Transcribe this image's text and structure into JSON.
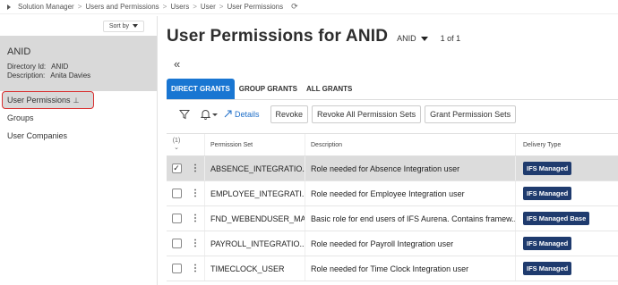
{
  "breadcrumb": {
    "items": [
      "Solution Manager",
      "Users and Permissions",
      "Users",
      "User",
      "User Permissions"
    ]
  },
  "sidebar": {
    "sort_label": "Sort by",
    "record": {
      "title": "ANID",
      "directory_label": "Directory Id:",
      "directory_value": "ANID",
      "description_label": "Description:",
      "description_value": "Anita Davies"
    },
    "items": [
      {
        "label": "User Permissions"
      },
      {
        "label": "Groups"
      },
      {
        "label": "User Companies"
      }
    ]
  },
  "header": {
    "title": "User Permissions for ANID",
    "selector_value": "ANID",
    "pager": "1 of 1"
  },
  "tabs": [
    {
      "label": "DIRECT GRANTS"
    },
    {
      "label": "GROUP GRANTS"
    },
    {
      "label": "ALL GRANTS"
    }
  ],
  "toolbar": {
    "details_label": "Details",
    "revoke_label": "Revoke",
    "revoke_all_label": "Revoke All Permission Sets",
    "grant_label": "Grant Permission Sets"
  },
  "table": {
    "selected_count": "(1)",
    "columns": {
      "permission_set": "Permission Set",
      "description": "Description",
      "delivery_type": "Delivery Type"
    },
    "rows": [
      {
        "permission_set": "ABSENCE_INTEGRATIO...",
        "description": "Role needed for Absence Integration user",
        "delivery_type": "IFS Managed",
        "selected": true
      },
      {
        "permission_set": "EMPLOYEE_INTEGRATI...",
        "description": "Role needed for Employee Integration user",
        "delivery_type": "IFS Managed",
        "selected": false
      },
      {
        "permission_set": "FND_WEBENDUSER_MA...",
        "description": "Basic role for end users of IFS Aurena. Contains framew...",
        "delivery_type": "IFS Managed Base",
        "selected": false
      },
      {
        "permission_set": "PAYROLL_INTEGRATIO...",
        "description": "Role needed for Payroll Integration user",
        "delivery_type": "IFS Managed",
        "selected": false
      },
      {
        "permission_set": "TIMECLOCK_USER",
        "description": "Role needed for Time Clock Integration user",
        "delivery_type": "IFS Managed",
        "selected": false
      }
    ]
  },
  "colors": {
    "accent": "#1976d2",
    "badge": "#1f3b6e",
    "highlight_border": "#d93030"
  }
}
